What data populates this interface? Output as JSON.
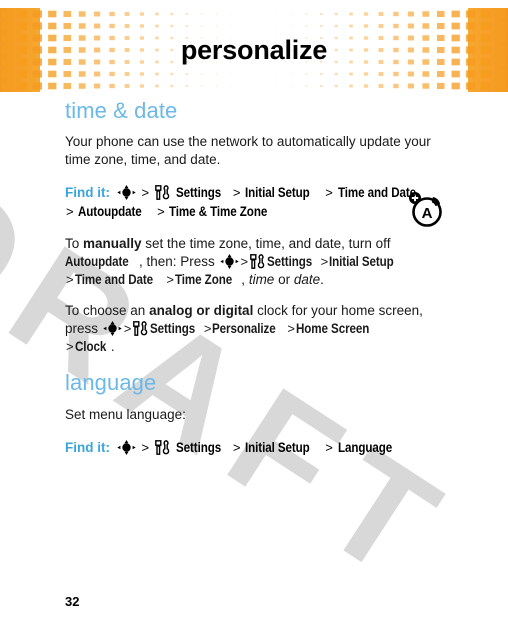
{
  "document": {
    "page_number": "32",
    "watermark": "DRAFT"
  },
  "header": {
    "title": "personalize",
    "background_color": "#f59d20",
    "pattern": "checkerboard-squares-gradient"
  },
  "colors": {
    "heading_blue": "#6cb8e8",
    "findit_blue": "#3aa5dd",
    "banner_orange": "#f59d20",
    "watermark_grey": "#d8d8d8"
  },
  "sections": [
    {
      "id": "time-and-date",
      "heading": "time & date",
      "intro": "Your phone can use the network to automatically update your time zone, time, and date.",
      "findit": {
        "label": "Find it:",
        "path": [
          "Settings",
          "Initial Setup",
          "Time and Date",
          "Autoupdate",
          "Time & Time Zone"
        ]
      },
      "paragraph_manual": {
        "lead": "To ",
        "bold1": "manually",
        "mid": " set the time zone, time, and date, turn off ",
        "menu1": "Autoupdate",
        "mid2": ", then: Press ",
        "path": [
          "Settings",
          "Initial Setup",
          "Time and Date",
          "Time Zone"
        ],
        "tail_italic1": "time",
        "tail_mid": " or ",
        "tail_italic2": "date",
        "tail_end": "."
      },
      "paragraph_clock": {
        "lead": "To choose an ",
        "bold1": "analog or digital",
        "mid": " clock for your home screen, press ",
        "path": [
          "Settings",
          "Personalize",
          "Home Screen",
          "Clock"
        ],
        "tail_end": "."
      }
    },
    {
      "id": "language",
      "heading": "language",
      "intro": "Set menu language:",
      "findit": {
        "label": "Find it:",
        "path": [
          "Settings",
          "Initial Setup",
          "Language"
        ]
      }
    }
  ],
  "icons": {
    "nav_key": "5-way-navigation-key-icon",
    "settings": "settings-tools-icon",
    "margin": "auto-signal-icon",
    "separator": ">"
  }
}
